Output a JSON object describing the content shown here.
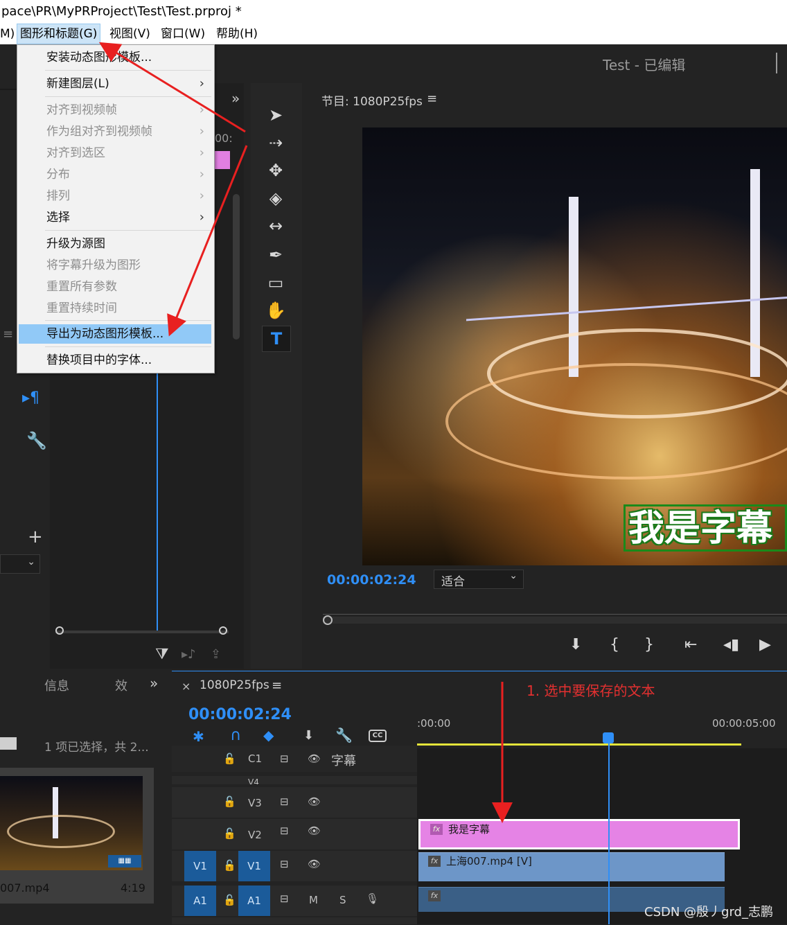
{
  "title_bar": {
    "path": "pace\\PR\\MyPRProject\\Test\\Test.prproj *"
  },
  "menu": {
    "items": [
      {
        "label": "M)"
      },
      {
        "label": "图形和标题(G)"
      },
      {
        "label": "视图(V)"
      },
      {
        "label": "窗口(W)"
      },
      {
        "label": "帮助(H)"
      }
    ]
  },
  "dropdown": {
    "items": [
      {
        "label": "安装动态图形模板..."
      },
      {
        "label": "新建图层(L)"
      },
      {
        "label": "对齐到视频帧"
      },
      {
        "label": "作为组对齐到视频帧"
      },
      {
        "label": "对齐到选区"
      },
      {
        "label": "分布"
      },
      {
        "label": "排列"
      },
      {
        "label": "选择"
      },
      {
        "label": "升级为源图"
      },
      {
        "label": "将字幕升级为图形"
      },
      {
        "label": "重置所有参数"
      },
      {
        "label": "重置持续时间"
      },
      {
        "label": "导出为动态图形模板..."
      },
      {
        "label": "替换项目中的字体..."
      }
    ]
  },
  "header": {
    "sequence_title": "Test - 已编辑"
  },
  "program_monitor": {
    "title": "节目: 1080P25fps",
    "timecode": "00:00:02:24",
    "zoom": "适合",
    "caption": "我是字幕"
  },
  "mid_panel": {
    "timecode_fragment": "00:"
  },
  "bottom_left": {
    "tab_info": "信息",
    "tab_effects": "效",
    "selection_status": "1 项已选择，共 2...",
    "clip_name": "007.mp4",
    "clip_duration": "4:19"
  },
  "timeline": {
    "sequence_name": "1080P25fps",
    "timecode": "00:00:02:24",
    "ruler_start": ":00:00",
    "ruler_end": "00:00:05:00",
    "annotation": "1. 选中要保存的文本",
    "tracks": {
      "c1": {
        "label": "C1",
        "name": "字幕"
      },
      "v4": {
        "label": "V4"
      },
      "v3": {
        "label": "V3"
      },
      "v2": {
        "label": "V2"
      },
      "v1": {
        "label": "V1",
        "source": "V1"
      },
      "a1": {
        "label": "A1",
        "source": "A1",
        "m": "M",
        "s": "S"
      }
    },
    "clips": {
      "title_clip": "我是字幕",
      "video_clip": "上海007.mp4 [V]"
    }
  },
  "watermark": "CSDN @殷丿grd_志鹏",
  "icons": {
    "fx": "fx",
    "cc": "CC"
  }
}
